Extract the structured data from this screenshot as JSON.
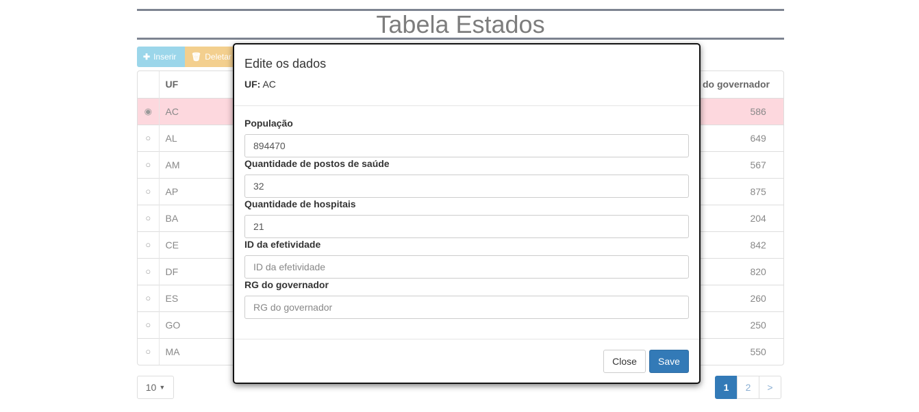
{
  "page": {
    "title": "Tabela Estados"
  },
  "toolbar": {
    "insert_icon": "plus-icon",
    "insert_label": "Inserir",
    "delete_icon": "trash-icon",
    "delete_label": "Deletar"
  },
  "table": {
    "headers": {
      "uf": "UF",
      "governor_rg": "do governador"
    },
    "rows": [
      {
        "uf": "AC",
        "rg": "586",
        "selected": true
      },
      {
        "uf": "AL",
        "rg": "649"
      },
      {
        "uf": "AM",
        "rg": "567"
      },
      {
        "uf": "AP",
        "rg": "875"
      },
      {
        "uf": "BA",
        "rg": "204"
      },
      {
        "uf": "CE",
        "rg": "842"
      },
      {
        "uf": "DF",
        "rg": "820"
      },
      {
        "uf": "ES",
        "rg": "260"
      },
      {
        "uf": "GO",
        "rg": "250"
      },
      {
        "uf": "MA",
        "rg": "550"
      }
    ],
    "selected_color": "#fdd8de"
  },
  "page_size": {
    "value": "10"
  },
  "pagination": {
    "pages": [
      "1",
      "2"
    ],
    "next": ">",
    "active": "1"
  },
  "modal": {
    "title": "Edite os dados",
    "uf_label": "UF:",
    "uf_value": "AC",
    "fields": {
      "populacao": {
        "label": "População",
        "value": "894470",
        "placeholder": ""
      },
      "postos": {
        "label": "Quantidade de postos de saúde",
        "value": "32",
        "placeholder": ""
      },
      "hospitais": {
        "label": "Quantidade de hospitais",
        "value": "21",
        "placeholder": ""
      },
      "efetividade": {
        "label": "ID da efetividade",
        "value": "",
        "placeholder": "ID da efetividade"
      },
      "rg_governador": {
        "label": "RG do governador",
        "value": "",
        "placeholder": "RG do governador"
      }
    },
    "close_label": "Close",
    "save_label": "Save"
  },
  "colors": {
    "primary": "#337ab7",
    "info": "#9bd6ea",
    "warning": "#f3cf8e"
  }
}
